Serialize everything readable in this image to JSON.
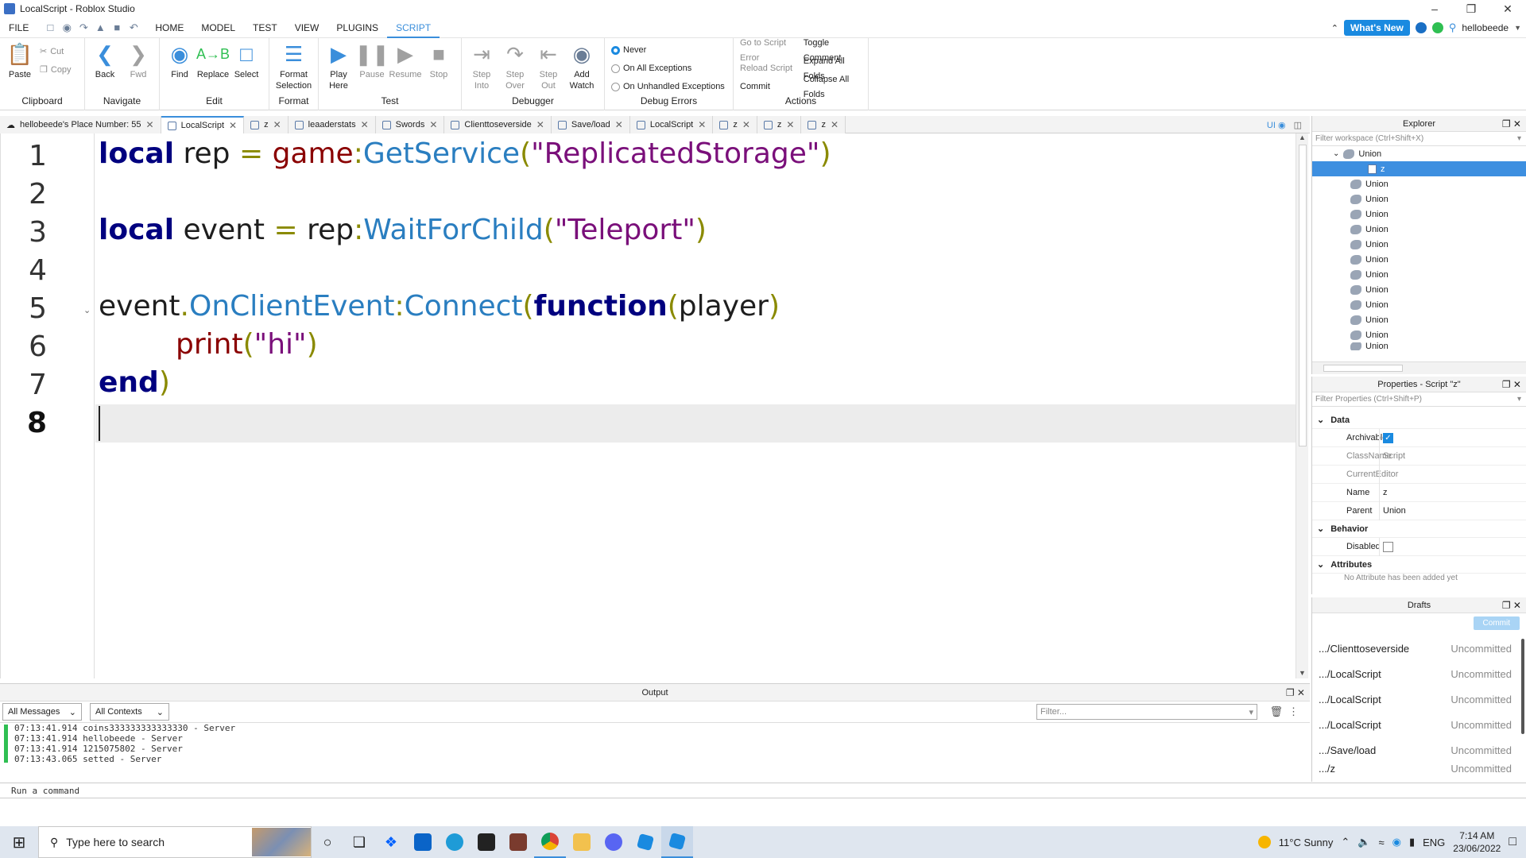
{
  "window": {
    "title": "LocalScript - Roblox Studio"
  },
  "menu": {
    "items": [
      "FILE",
      "HOME",
      "MODEL",
      "TEST",
      "VIEW",
      "PLUGINS",
      "SCRIPT"
    ],
    "active": "SCRIPT"
  },
  "topright": {
    "whats_new": "What's New",
    "username": "hellobeede"
  },
  "ribbon": {
    "clipboard": {
      "paste": "Paste",
      "cut": "Cut",
      "copy": "Copy",
      "label": "Clipboard"
    },
    "navigate": {
      "back": "Back",
      "fwd": "Fwd",
      "label": "Navigate"
    },
    "edit": {
      "find": "Find",
      "replace": "Replace",
      "select": "Select",
      "label": "Edit"
    },
    "format": {
      "format_selection": "Format Selection",
      "label": "Format"
    },
    "test": {
      "play_here": "Play Here",
      "pause": "Pause",
      "resume": "Resume",
      "stop": "Stop",
      "label": "Test"
    },
    "debugger": {
      "step_into": "Step Into",
      "step_over": "Step Over",
      "step_out": "Step Out",
      "add_watch": "Add Watch",
      "label": "Debugger"
    },
    "debug_errors": {
      "never": "Never",
      "on_all": "On All Exceptions",
      "on_unhandled": "On Unhandled Exceptions",
      "label": "Debug Errors"
    },
    "actions": {
      "go_to_error": "Go to Script Error",
      "reload": "Reload Script",
      "commit": "Commit",
      "toggle_comment": "Toggle Comment",
      "expand_all": "Expand All Folds",
      "collapse_all": "Collapse All Folds",
      "label": "Actions"
    }
  },
  "tabs": [
    {
      "label": "hellobeede's Place Number: 55"
    },
    {
      "label": "LocalScript"
    },
    {
      "label": "z"
    },
    {
      "label": "leaaderstats"
    },
    {
      "label": "Swords"
    },
    {
      "label": "Clienttoseverside"
    },
    {
      "label": "Save/load"
    },
    {
      "label": "LocalScript"
    },
    {
      "label": "z"
    },
    {
      "label": "z"
    },
    {
      "label": "z"
    }
  ],
  "tab_tools": {
    "ui": "UI"
  },
  "editor": {
    "line_numbers": [
      "1",
      "2",
      "3",
      "4",
      "5",
      "6",
      "7",
      "8"
    ],
    "l1": {
      "kw": "local",
      "a": " rep ",
      "eq": "=",
      "b": " ",
      "fn": "game",
      "c": ":",
      "m": "GetService",
      "p1": "(",
      "s": "\"ReplicatedStorage\"",
      "p2": ")"
    },
    "l3": {
      "kw": "local",
      "a": " event ",
      "eq": "=",
      "b": " rep",
      "c": ":",
      "m": "WaitForChild",
      "p1": "(",
      "s": "\"Teleport\"",
      "p2": ")"
    },
    "l5": {
      "a": "event",
      "d": ".",
      "m": "OnClientEvent",
      "c": ":",
      "m2": "Connect",
      "p1": "(",
      "kw": "function",
      "p2": "(",
      "b": "player",
      "p3": ")"
    },
    "l6": {
      "fn": "print",
      "p1": "(",
      "s": "\"hi\"",
      "p2": ")"
    },
    "l7": {
      "kw": "end",
      "p": ")"
    }
  },
  "output": {
    "title": "Output",
    "filter_messages": "All Messages",
    "filter_contexts": "All Contexts",
    "filter_placeholder": "Filter...",
    "lines": [
      "07:13:41.914  coins333333333333330  -  Server",
      "07:13:41.914  hellobeede  -  Server",
      "07:13:41.914  1215075802  -  Server",
      "07:13:43.065  setted  -  Server"
    ]
  },
  "command": {
    "placeholder": "Run a command"
  },
  "explorer": {
    "title": "Explorer",
    "filter": "Filter workspace (Ctrl+Shift+X)",
    "parent": "Union",
    "selected": "z",
    "items": [
      "Union",
      "Union",
      "Union",
      "Union",
      "Union",
      "Union",
      "Union",
      "Union",
      "Union",
      "Union",
      "Union",
      "Union"
    ]
  },
  "properties": {
    "title": "Properties - Script \"z\"",
    "filter": "Filter Properties (Ctrl+Shift+P)",
    "sections": {
      "data": "Data",
      "behavior": "Behavior",
      "attributes": "Attributes"
    },
    "rows": {
      "archivable": {
        "name": "Archivable",
        "value": "true"
      },
      "classname": {
        "name": "ClassName",
        "value": "Script"
      },
      "currenteditor": {
        "name": "CurrentEditor",
        "value": ""
      },
      "name": {
        "name": "Name",
        "value": "z"
      },
      "parent": {
        "name": "Parent",
        "value": "Union"
      },
      "disabled": {
        "name": "Disabled",
        "value": "false"
      }
    },
    "attributes_note": "No Attribute has been added yet"
  },
  "drafts": {
    "title": "Drafts",
    "commit": "Commit",
    "items": [
      {
        "name": ".../Clienttoseverside",
        "status": "Uncommitted"
      },
      {
        "name": ".../LocalScript",
        "status": "Uncommitted"
      },
      {
        "name": ".../LocalScript",
        "status": "Uncommitted"
      },
      {
        "name": ".../LocalScript",
        "status": "Uncommitted"
      },
      {
        "name": ".../Save/load",
        "status": "Uncommitted"
      },
      {
        "name": ".../z",
        "status": "Uncommitted"
      }
    ]
  },
  "taskbar": {
    "search_placeholder": "Type here to search",
    "weather": "11°C  Sunny",
    "lang": "ENG",
    "time": "7:14 AM",
    "date": "23/06/2022"
  }
}
